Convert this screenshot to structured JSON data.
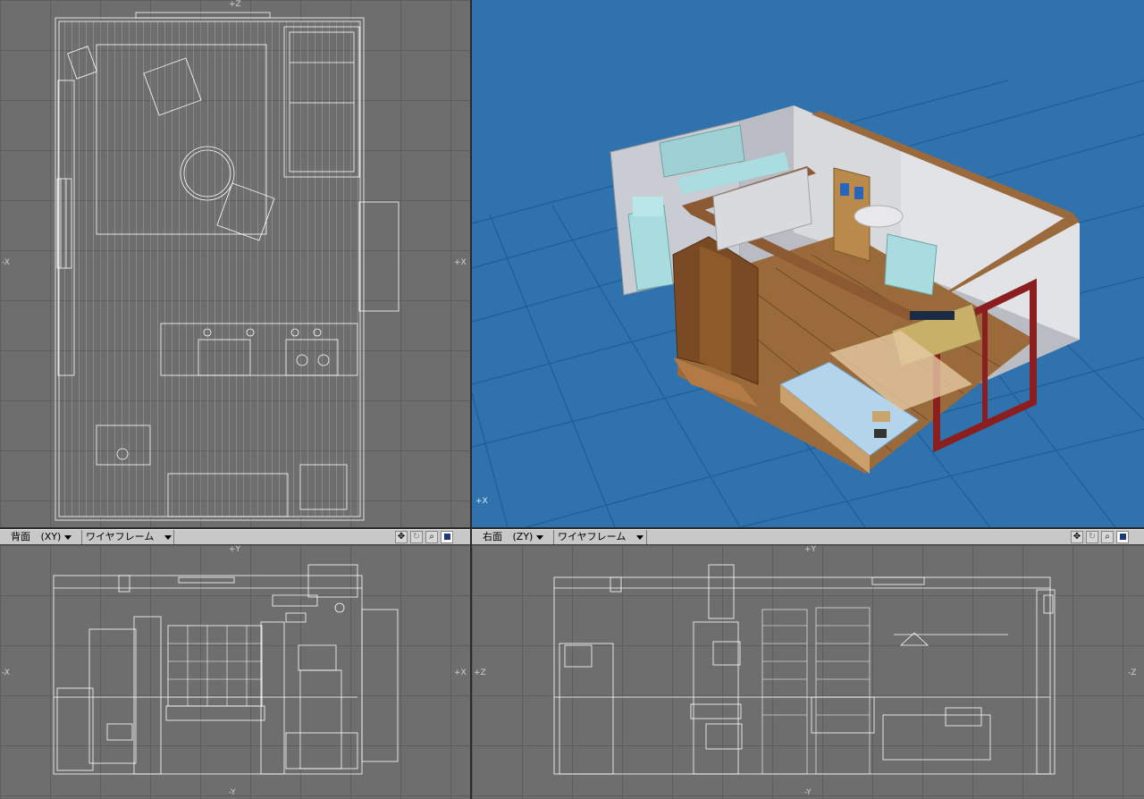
{
  "viewports": {
    "top": {
      "axis_top": "+Z",
      "axis_left": "-X",
      "axis_right": "+X"
    },
    "persp": {
      "axis_label": "+X"
    },
    "back": {
      "view_label": "背面",
      "axis_mode": "(XY)",
      "render_mode": "ワイヤフレーム",
      "axis_top": "+Y",
      "axis_left": "-X",
      "axis_right": "+X",
      "axis_bottom": "-Y"
    },
    "right": {
      "view_label": "右面",
      "axis_mode": "(ZY)",
      "render_mode": "ワイヤフレーム",
      "axis_top": "+Y",
      "axis_left": "+Z",
      "axis_right": "-Z",
      "axis_bottom": "-Y"
    }
  },
  "toolbar_icons": [
    "move-view-icon",
    "rotate-view-icon",
    "zoom-view-icon",
    "maximize-view-icon"
  ],
  "colors": {
    "grid_bg": "#6e6e6e",
    "wire": "#ffffff",
    "persp_bg": "#2f72ad",
    "persp_grid": "#1f5f96"
  }
}
